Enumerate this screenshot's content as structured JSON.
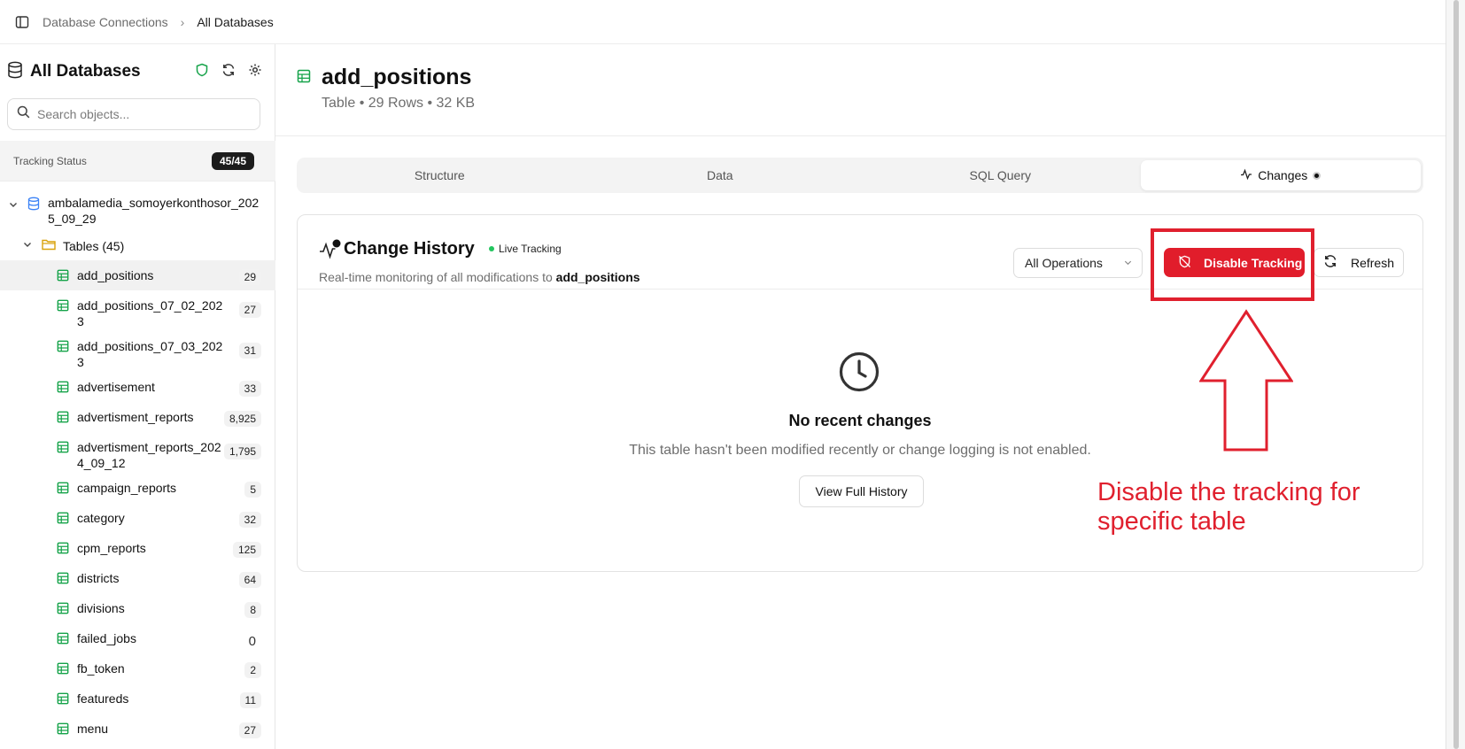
{
  "breadcrumb": {
    "items": [
      "Database Connections",
      "All Databases"
    ]
  },
  "sidebar": {
    "title": "All Databases",
    "search_placeholder": "Search objects...",
    "tracking_label": "Tracking Status",
    "tracking_count": "45/45",
    "database_name": "ambalamedia_somoyerkonthosor_2025_09_29",
    "tables_label": "Tables (45)",
    "tables": [
      {
        "name": "add_positions",
        "count": "29"
      },
      {
        "name": "add_positions_07_02_2023",
        "count": "27"
      },
      {
        "name": "add_positions_07_03_2023",
        "count": "31"
      },
      {
        "name": "advertisement",
        "count": "33"
      },
      {
        "name": "advertisment_reports",
        "count": "8,925"
      },
      {
        "name": "advertisment_reports_2024_09_12",
        "count": "1,795"
      },
      {
        "name": "campaign_reports",
        "count": "5"
      },
      {
        "name": "category",
        "count": "32"
      },
      {
        "name": "cpm_reports",
        "count": "125"
      },
      {
        "name": "districts",
        "count": "64"
      },
      {
        "name": "divisions",
        "count": "8"
      },
      {
        "name": "failed_jobs",
        "count": "0"
      },
      {
        "name": "fb_token",
        "count": "2"
      },
      {
        "name": "featureds",
        "count": "11"
      },
      {
        "name": "menu",
        "count": "27"
      }
    ]
  },
  "header": {
    "title": "add_positions",
    "subtitle": "Table • 29 Rows • 32 KB"
  },
  "tabs": [
    "Structure",
    "Data",
    "SQL Query",
    "Changes"
  ],
  "change_history": {
    "title": "Change History",
    "live_label": "Live Tracking",
    "desc_prefix": "Real-time monitoring of all modifications to",
    "desc_table": "add_positions",
    "operations_value": "All Operations",
    "disable_label": "Disable Tracking",
    "refresh_label": "Refresh",
    "empty_title": "No recent changes",
    "empty_desc": "This table hasn't been modified recently or change logging is not enabled.",
    "full_history_label": "View Full History"
  },
  "annotation": {
    "text_line1": "Disable the tracking for",
    "text_line2": "specific table"
  },
  "colors": {
    "accent_red": "#e11d2b",
    "table_icon_green": "#16a34a",
    "folder_yellow": "#d9a20b",
    "db_blue": "#3b82f6"
  }
}
